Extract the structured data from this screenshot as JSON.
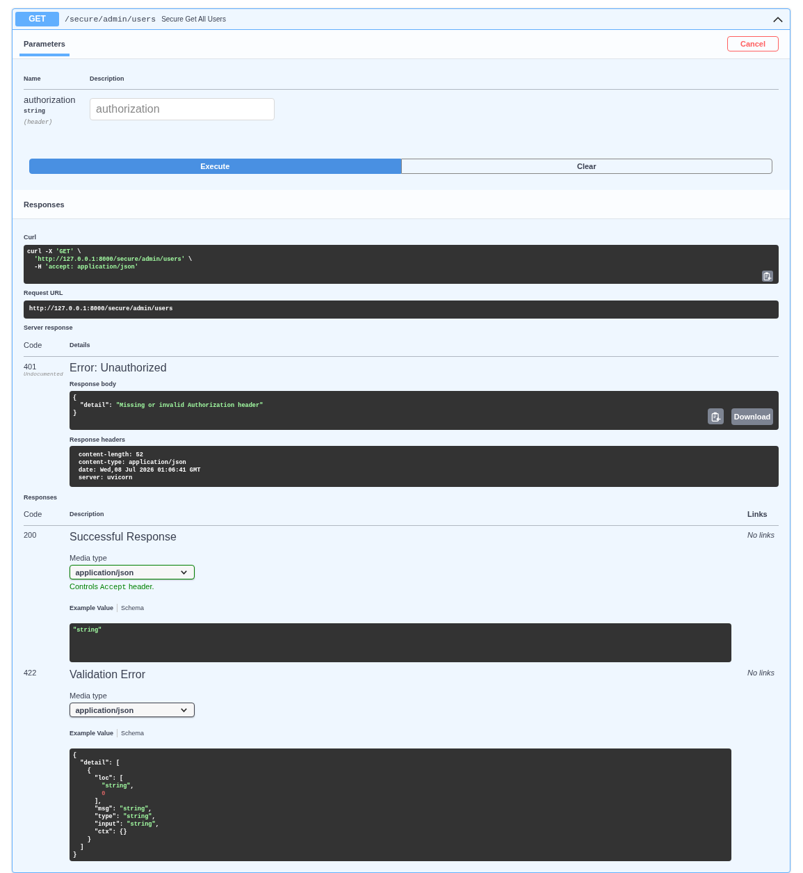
{
  "operation": {
    "method": "GET",
    "path": "/secure/admin/users",
    "summary": "Secure Get All Users",
    "expanded": true
  },
  "tabs": [
    {
      "label": "Parameters",
      "selected": true
    }
  ],
  "cancel_button": "Cancel",
  "parameters": {
    "columns": [
      "Name",
      "Description"
    ],
    "rows": [
      {
        "name": "authorization",
        "type": "string",
        "location": "(header)",
        "placeholder": "authorization"
      }
    ]
  },
  "actions": [
    {
      "label": "Execute",
      "kind": "execute"
    },
    {
      "label": "Clear",
      "kind": "clear"
    }
  ],
  "responses_header": "Responses",
  "curl": {
    "label": "Curl",
    "lines": [
      [
        {
          "text": "curl -X ",
          "kind": "plain"
        },
        {
          "text": "'GET'",
          "kind": "string"
        },
        {
          "text": " \\",
          "kind": "plain"
        }
      ],
      [
        {
          "text": "  'http://127.0.0.1:8000/secure/admin/users'",
          "kind": "string"
        },
        {
          "text": " \\",
          "kind": "plain"
        }
      ],
      [
        {
          "text": "  -H ",
          "kind": "plain"
        },
        {
          "text": "'accept: application/json'",
          "kind": "string"
        }
      ]
    ]
  },
  "request_url": {
    "label": "Request URL",
    "value": "http://127.0.0.1:8000/secure/admin/users"
  },
  "server_response": {
    "label": "Server response",
    "columns": [
      "Code",
      "Details"
    ],
    "code": "401",
    "code_note": "Undocumented",
    "title": "Error: Unauthorized",
    "body_label": "Response body",
    "body_lines": [
      [
        {
          "text": "{",
          "kind": "plain"
        }
      ],
      [
        {
          "text": "  \"detail\": ",
          "kind": "plain"
        },
        {
          "text": "\"Missing or invalid Authorization header\"",
          "kind": "string"
        }
      ],
      [
        {
          "text": "}",
          "kind": "plain"
        }
      ]
    ],
    "download_button": "Download",
    "headers_label": "Response headers",
    "header_lines": [
      "content-length: 52",
      "content-type: application/json",
      "date: Wed,08 Jul 2026 01:06:41 GMT",
      "server: uvicorn"
    ]
  },
  "responses": {
    "label": "Responses",
    "columns": [
      "Code",
      "Description",
      "Links"
    ],
    "rows": [
      {
        "code": "200",
        "description": "Successful Response",
        "links": "No links",
        "media_label": "Media type",
        "media_type": "application/json",
        "controls_accept": true,
        "accept_note": {
          "before": "Controls",
          "code": "Accept",
          "after": "header."
        },
        "example_tabs": [
          {
            "label": "Example Value",
            "selected": true
          },
          {
            "label": "Schema",
            "selected": false
          }
        ],
        "example_lines": [
          [
            {
              "text": "\"string\"",
              "kind": "string"
            }
          ]
        ]
      },
      {
        "code": "422",
        "description": "Validation Error",
        "links": "No links",
        "media_label": "Media type",
        "media_type": "application/json",
        "controls_accept": false,
        "example_tabs": [
          {
            "label": "Example Value",
            "selected": true
          },
          {
            "label": "Schema",
            "selected": false
          }
        ],
        "example_lines": [
          [
            {
              "text": "{",
              "kind": "plain"
            }
          ],
          [
            {
              "text": "  \"detail\": [",
              "kind": "plain"
            }
          ],
          [
            {
              "text": "    {",
              "kind": "plain"
            }
          ],
          [
            {
              "text": "      \"loc\": [",
              "kind": "plain"
            }
          ],
          [
            {
              "text": "        \"string\"",
              "kind": "string"
            },
            {
              "text": ",",
              "kind": "plain"
            }
          ],
          [
            {
              "text": "        0",
              "kind": "number"
            }
          ],
          [
            {
              "text": "      ],",
              "kind": "plain"
            }
          ],
          [
            {
              "text": "      \"msg\": ",
              "kind": "plain"
            },
            {
              "text": "\"string\"",
              "kind": "string"
            },
            {
              "text": ",",
              "kind": "plain"
            }
          ],
          [
            {
              "text": "      \"type\": ",
              "kind": "plain"
            },
            {
              "text": "\"string\"",
              "kind": "string"
            },
            {
              "text": ",",
              "kind": "plain"
            }
          ],
          [
            {
              "text": "      \"input\": ",
              "kind": "plain"
            },
            {
              "text": "\"string\"",
              "kind": "string"
            },
            {
              "text": ",",
              "kind": "plain"
            }
          ],
          [
            {
              "text": "      \"ctx\": {}",
              "kind": "plain"
            }
          ],
          [
            {
              "text": "    }",
              "kind": "plain"
            }
          ],
          [
            {
              "text": "  ]",
              "kind": "plain"
            }
          ],
          [
            {
              "text": "}",
              "kind": "plain"
            }
          ]
        ]
      }
    ]
  }
}
